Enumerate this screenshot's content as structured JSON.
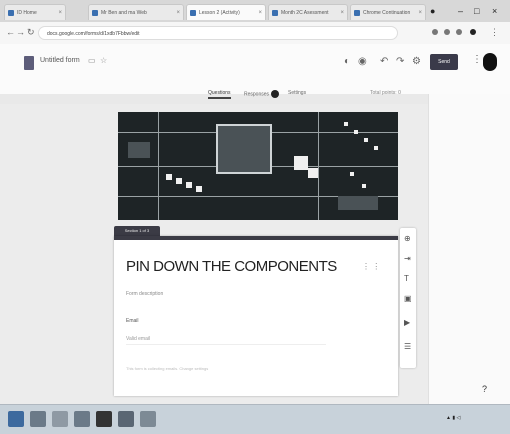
{
  "browser": {
    "tabs": [
      {
        "label": "ID Home"
      },
      {
        "label": "Mr Ben and ma Web"
      },
      {
        "label": "Lesson 2 (Activity)"
      },
      {
        "label": "Month 2C Asessment"
      },
      {
        "label": "Chrome Continuation"
      }
    ],
    "url": "docs.google.com/forms/d/1xdb7Fbbw/edit"
  },
  "app": {
    "doc_title": "Untitled form",
    "send_label": "Send",
    "tabs": [
      {
        "label": "Questions"
      },
      {
        "label": "Responses"
      },
      {
        "label": "Settings"
      }
    ],
    "total_points": "Total points: 0"
  },
  "form": {
    "section_tab": "Section 1 of 3",
    "title": "PIN DOWN THE COMPONENTS",
    "description": "Form description",
    "field_label": "Email",
    "field_value": "Valid email",
    "field_hint": "This form is collecting emails. Change settings"
  },
  "accent": "#3b3b45"
}
